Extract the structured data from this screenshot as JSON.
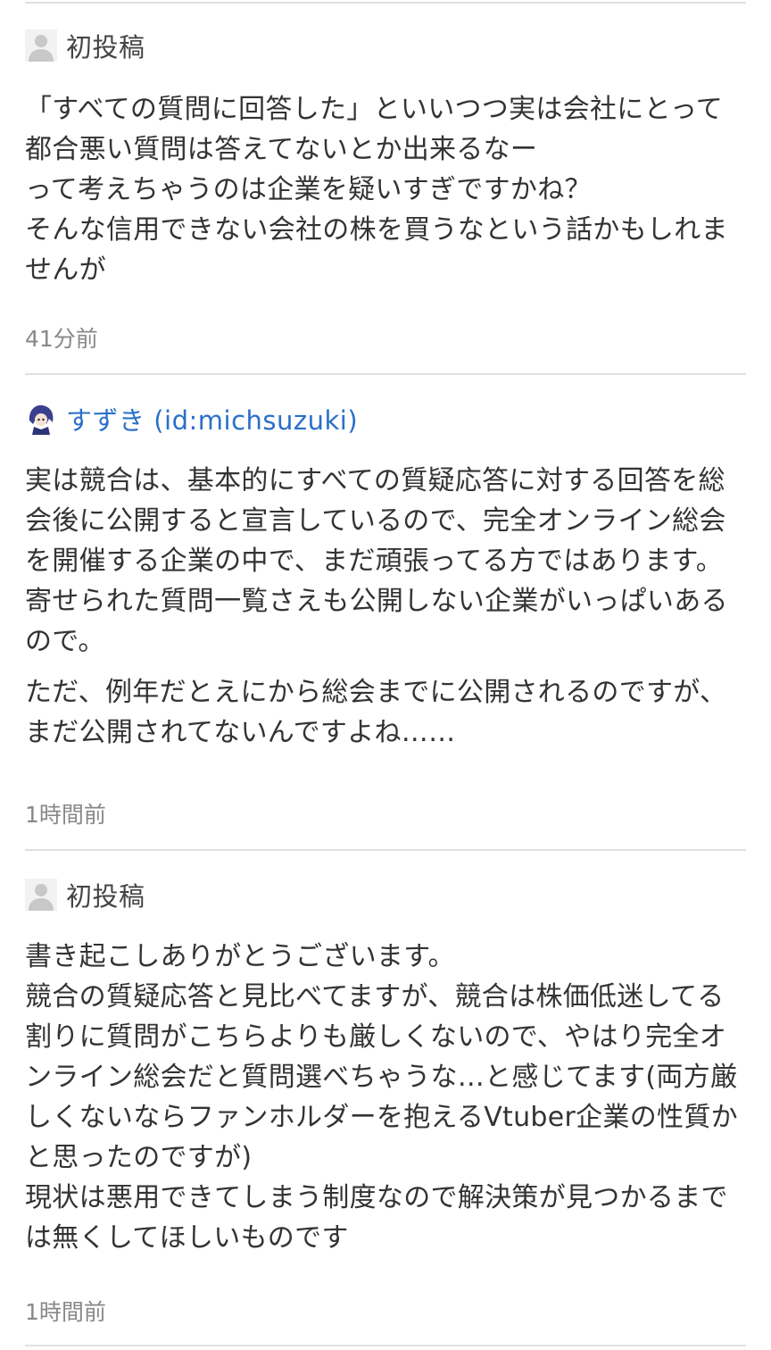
{
  "comments": [
    {
      "author": "初投稿",
      "avatar": "default-user-icon",
      "paragraphs": [
        "「すべての質問に回答した」といいつつ実は会社にとって都合悪い質問は答えてないとか出来るなー\nって考えちゃうのは企業を疑いすぎですかね？\nそんな信用できない会社の株を買うなという話かもしれませんが"
      ],
      "time": "41分前"
    },
    {
      "author": "すずき (id:michsuzuki)",
      "avatar": "user-avatar-icon",
      "paragraphs": [
        "実は競合は、基本的にすべての質疑応答に対する回答を総会後に公開すると宣言しているので、完全オンライン総会を開催する企業の中で、まだ頑張ってる方ではあります。寄せられた質問一覧さえも公開しない企業がいっぱいあるので。",
        "ただ、例年だとえにから総会までに公開されるのですが、まだ公開されてないんですよね……"
      ],
      "time": "1時間前"
    },
    {
      "author": "初投稿",
      "avatar": "default-user-icon",
      "paragraphs": [
        "書き起こしありがとうございます。\n競合の質疑応答と見比べてますが、競合は株価低迷してる割りに質問がこちらよりも厳しくないので、やはり完全オンライン総会だと質問選べちゃうな…と感じてます(両方厳しくないならファンホルダーを抱えるVtuber企業の性質かと思ったのですが)\n現状は悪用できてしまう制度なので解決策が見つかるまでは無くしてほしいものです"
      ],
      "time": "1時間前"
    }
  ],
  "colors": {
    "link": "#2a6fc9",
    "text": "#333333",
    "muted": "#888888",
    "divider": "#e0e0e0"
  }
}
